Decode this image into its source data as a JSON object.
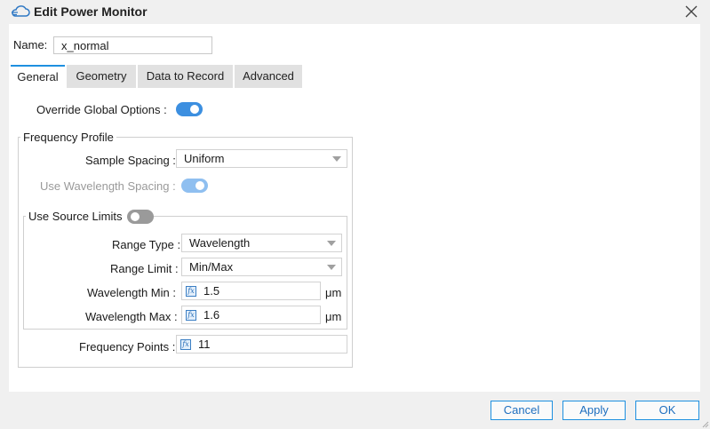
{
  "window": {
    "title": "Edit Power Monitor"
  },
  "name_field": {
    "label": "Name:",
    "value": "x_normal"
  },
  "tabs": [
    {
      "label": "General",
      "active": true
    },
    {
      "label": "Geometry",
      "active": false
    },
    {
      "label": "Data to Record",
      "active": false
    },
    {
      "label": "Advanced",
      "active": false
    }
  ],
  "general": {
    "override_label": "Override Global Options :",
    "override_on": true,
    "frequency_profile": {
      "legend": "Frequency Profile",
      "sample_spacing_label": "Sample Spacing :",
      "sample_spacing_value": "Uniform",
      "use_wavelength_label": "Use Wavelength Spacing :",
      "use_wavelength_on": true,
      "use_wavelength_disabled": true,
      "source_limits": {
        "legend": "Use Source Limits",
        "on": false,
        "range_type_label": "Range Type :",
        "range_type_value": "Wavelength",
        "range_limit_label": "Range Limit :",
        "range_limit_value": "Min/Max",
        "wl_min_label": "Wavelength Min :",
        "wl_min_value": "1.5",
        "wl_min_unit": "μm",
        "wl_max_label": "Wavelength Max :",
        "wl_max_value": "1.6",
        "wl_max_unit": "μm"
      },
      "freq_points_label": "Frequency Points :",
      "freq_points_value": "11"
    }
  },
  "buttons": {
    "cancel": "Cancel",
    "apply": "Apply",
    "ok": "OK"
  },
  "colors": {
    "accent": "#1e90e0",
    "toggle_on": "#3c8fe0",
    "toggle_on_disabled": "#8fbff0",
    "toggle_off": "#9a9a9a"
  },
  "icons": {
    "title": "cloud-icon",
    "close": "close-icon",
    "fx": "function-icon",
    "dropdown": "chevron-down-icon"
  }
}
